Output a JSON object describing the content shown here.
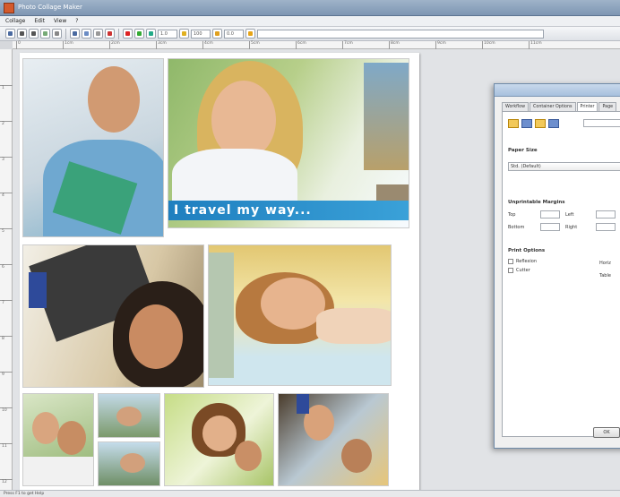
{
  "window": {
    "title": "Photo Collage Maker"
  },
  "menubar": {
    "items": [
      "Collage",
      "Edit",
      "View",
      "?"
    ]
  },
  "toolbar": {
    "fields": [
      "1.0",
      "100",
      "0.0"
    ]
  },
  "ruler": {
    "horizontal_ticks": [
      "0",
      "1cm",
      "2cm",
      "3cm",
      "4cm",
      "5cm",
      "6cm",
      "7cm",
      "8cm",
      "9cm",
      "10cm",
      "11cm"
    ],
    "vertical_ticks": [
      "1",
      "2",
      "3",
      "4",
      "5",
      "6",
      "7",
      "8",
      "9",
      "10",
      "11",
      "12"
    ]
  },
  "canvas": {
    "banner_text": "I travel my way..."
  },
  "dialog": {
    "tabs": [
      "Workflow",
      "Container Options",
      "Printer",
      "Page"
    ],
    "section_paper_size": "Paper Size",
    "paper_size_value": "Std. (Default)",
    "section_margins": "Unprintable Margins",
    "margin_labels": [
      "Top",
      "Left",
      "Bottom",
      "Right"
    ],
    "section_print_options": "Print Options",
    "print_options": [
      "Reflexion",
      "Cutter"
    ],
    "right_labels": [
      "Horiz",
      "Table"
    ],
    "ok_label": "OK"
  },
  "statusbar": {
    "text": "Press F1 to get Help"
  }
}
